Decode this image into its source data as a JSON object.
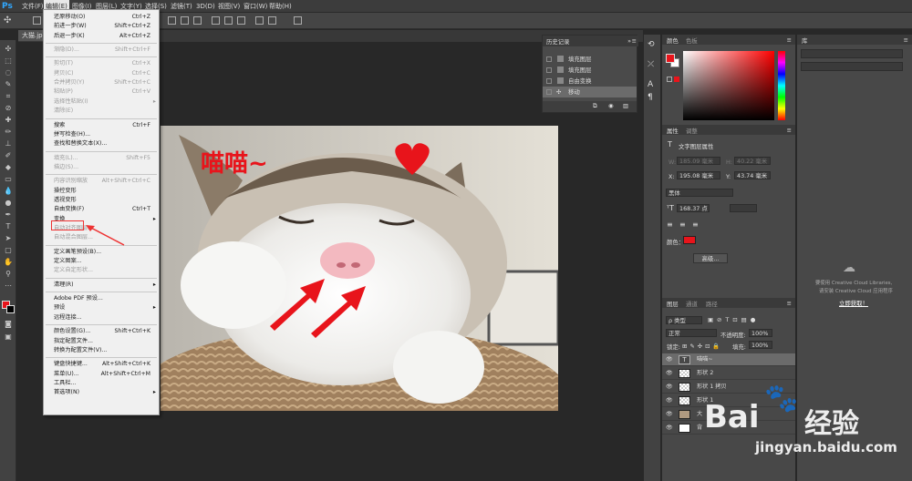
{
  "app": {
    "logo": "Ps"
  },
  "menubar": [
    "文件(F)",
    "编辑(E)",
    "图像(I)",
    "图层(L)",
    "文字(Y)",
    "选择(S)",
    "滤镜(T)",
    "3D(D)",
    "视图(V)",
    "窗口(W)",
    "帮助(H)"
  ],
  "doc_tab": {
    "label": "大猫.jp"
  },
  "edit_menu": {
    "items": [
      {
        "label": "还原移动(O)",
        "shortcut": "Ctrl+Z",
        "disabled": false
      },
      {
        "label": "前进一步(W)",
        "shortcut": "Shift+Ctrl+Z",
        "disabled": false
      },
      {
        "label": "后退一步(K)",
        "shortcut": "Alt+Ctrl+Z",
        "disabled": false
      },
      {
        "sep": true
      },
      {
        "label": "渐隐(D)...",
        "shortcut": "Shift+Ctrl+F",
        "disabled": true
      },
      {
        "sep": true
      },
      {
        "label": "剪切(T)",
        "shortcut": "Ctrl+X",
        "disabled": true
      },
      {
        "label": "拷贝(C)",
        "shortcut": "Ctrl+C",
        "disabled": true
      },
      {
        "label": "合并拷贝(Y)",
        "shortcut": "Shift+Ctrl+C",
        "disabled": true
      },
      {
        "label": "粘贴(P)",
        "shortcut": "Ctrl+V",
        "disabled": true
      },
      {
        "label": "选择性粘贴(I)",
        "shortcut": "",
        "disabled": true,
        "arrow": true
      },
      {
        "label": "清除(E)",
        "shortcut": "",
        "disabled": true
      },
      {
        "sep": true
      },
      {
        "label": "搜索",
        "shortcut": "Ctrl+F",
        "disabled": false
      },
      {
        "label": "拼写检查(H)...",
        "shortcut": "",
        "disabled": false
      },
      {
        "label": "查找和替换文本(X)...",
        "shortcut": "",
        "disabled": false
      },
      {
        "sep": true
      },
      {
        "label": "填充(L)...",
        "shortcut": "Shift+F5",
        "disabled": true
      },
      {
        "label": "描边(S)...",
        "shortcut": "",
        "disabled": true
      },
      {
        "sep": true
      },
      {
        "label": "内容识别缩放",
        "shortcut": "Alt+Shift+Ctrl+C",
        "disabled": true
      },
      {
        "label": "操控变形",
        "shortcut": "",
        "disabled": false
      },
      {
        "label": "透视变形",
        "shortcut": "",
        "disabled": false
      },
      {
        "label": "自由变换(F)",
        "shortcut": "Ctrl+T",
        "disabled": false
      },
      {
        "label": "变换",
        "shortcut": "",
        "disabled": false,
        "arrow": true
      },
      {
        "label": "自动对齐图层...",
        "shortcut": "",
        "disabled": true
      },
      {
        "label": "自动混合图层...",
        "shortcut": "",
        "disabled": true
      },
      {
        "sep": true
      },
      {
        "label": "定义画笔预设(B)...",
        "shortcut": "",
        "disabled": false
      },
      {
        "label": "定义图案...",
        "shortcut": "",
        "disabled": false
      },
      {
        "label": "定义自定形状...",
        "shortcut": "",
        "disabled": true
      },
      {
        "sep": true
      },
      {
        "label": "清理(R)",
        "shortcut": "",
        "disabled": false,
        "arrow": true
      },
      {
        "sep": true
      },
      {
        "label": "Adobe PDF 预设...",
        "shortcut": "",
        "disabled": false
      },
      {
        "label": "预设",
        "shortcut": "",
        "disabled": false,
        "arrow": true
      },
      {
        "label": "远程连接...",
        "shortcut": "",
        "disabled": false
      },
      {
        "sep": true
      },
      {
        "label": "颜色设置(G)...",
        "shortcut": "Shift+Ctrl+K",
        "disabled": false
      },
      {
        "label": "指定配置文件...",
        "shortcut": "",
        "disabled": false
      },
      {
        "label": "转换为配置文件(V)...",
        "shortcut": "",
        "disabled": false
      },
      {
        "sep": true
      },
      {
        "label": "键盘快捷键...",
        "shortcut": "Alt+Shift+Ctrl+K",
        "disabled": false
      },
      {
        "label": "菜单(U)...",
        "shortcut": "Alt+Shift+Ctrl+M",
        "disabled": false
      },
      {
        "label": "工具栏...",
        "shortcut": "",
        "disabled": false
      },
      {
        "label": "首选项(N)",
        "shortcut": "",
        "disabled": false,
        "arrow": true
      }
    ]
  },
  "canvas": {
    "caption": "喵喵~",
    "heart_color": "#e8141b",
    "arrow_color": "#e8141b"
  },
  "history": {
    "title": "历史记录",
    "items": [
      {
        "label": "填充图层",
        "selected": false
      },
      {
        "label": "填充图层",
        "selected": false
      },
      {
        "label": "自由变换",
        "selected": false
      },
      {
        "label": "移动",
        "selected": true
      }
    ]
  },
  "color_panel": {
    "tabs": [
      "颜色",
      "色板"
    ],
    "fg": "#e8141b",
    "bg": "#ffffff"
  },
  "properties": {
    "tabs": [
      "属性",
      "调整"
    ],
    "header": "文字图层属性",
    "w_label": "W:",
    "w_value": "185.09 毫米",
    "h_label": "H:",
    "h_value": "40.22 毫米",
    "x_label": "X:",
    "x_value": "195.08 毫米",
    "y_label": "Y:",
    "y_value": "43.74 毫米",
    "font": "黑体",
    "size": "168.37 点",
    "color_label": "颜色：",
    "advanced": "高级...",
    "color": "#e8141b"
  },
  "layers": {
    "tabs": [
      "图层",
      "通道",
      "路径"
    ],
    "filter": "ρ 类型",
    "blend": "正常",
    "opacity_label": "不透明度:",
    "opacity": "100%",
    "lock_label": "锁定:",
    "fill_label": "填充:",
    "fill": "100%",
    "items": [
      {
        "name": "喵喵~",
        "kind": "text",
        "selected": true
      },
      {
        "name": "形状 2",
        "kind": "shape",
        "selected": false
      },
      {
        "name": "形状 1 拷贝",
        "kind": "shape",
        "selected": false
      },
      {
        "name": "形状 1",
        "kind": "shape",
        "selected": false
      },
      {
        "name": "大",
        "kind": "image",
        "selected": false
      },
      {
        "name": "背",
        "kind": "bg",
        "selected": false
      }
    ]
  },
  "libraries": {
    "tab": "库",
    "line1": "要使用 Creative Cloud Libraries,",
    "line2": "请安装 Creative Cloud 应用程序",
    "link": "立即获取！"
  },
  "watermark": {
    "brand_left": "Bai",
    "brand_right": "经验",
    "url": "jingyan.baidu.com",
    "color": "#ffffff"
  }
}
